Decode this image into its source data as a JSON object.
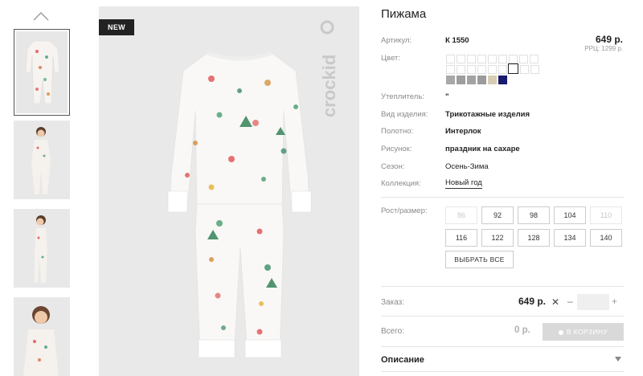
{
  "product": {
    "badge": "NEW",
    "brand": "crockid",
    "title": "Пижама",
    "price": "649 р.",
    "rrp": "РРЦ: 1299 р."
  },
  "attributes": [
    {
      "label": "Артикул:",
      "value": "К 1550",
      "bold": true
    },
    {
      "label": "Цвет:",
      "value": ""
    },
    {
      "label": "Утеплитель:",
      "value": "\""
    },
    {
      "label": "Вид изделия:",
      "value": "Трикотажные изделия",
      "bold": true
    },
    {
      "label": "Полотно:",
      "value": "Интерлок",
      "bold": true
    },
    {
      "label": "Рисунок:",
      "value": "праздник на сахаре",
      "bold": true
    },
    {
      "label": "Сезон:",
      "value": "Осень-Зима",
      "bold": false
    },
    {
      "label": "Коллекция:",
      "value": "Новый год",
      "link": true
    }
  ],
  "colors": {
    "row3": [
      "#a8a8a8",
      "#9e9e9e",
      "#a3a3a3",
      "#9b9b9b",
      "#d8cdb2",
      "#1a1a6e"
    ]
  },
  "sizes": {
    "label": "Рост/размер:",
    "row1": [
      "86",
      "92",
      "98",
      "104",
      "110"
    ],
    "row2": [
      "116",
      "122",
      "128",
      "134",
      "140"
    ],
    "disabled": [
      "86",
      "110"
    ],
    "select_all": "ВЫБРАТЬ ВСЕ"
  },
  "order": {
    "label": "Заказ:",
    "price": "649 р.",
    "remove_symbol": "✕",
    "minus": "–",
    "plus": "+",
    "quantity": ""
  },
  "total": {
    "label": "Всего:",
    "value": "0 р.",
    "cart_button": "В КОРЗИНУ"
  },
  "description": {
    "label": "Описание"
  }
}
